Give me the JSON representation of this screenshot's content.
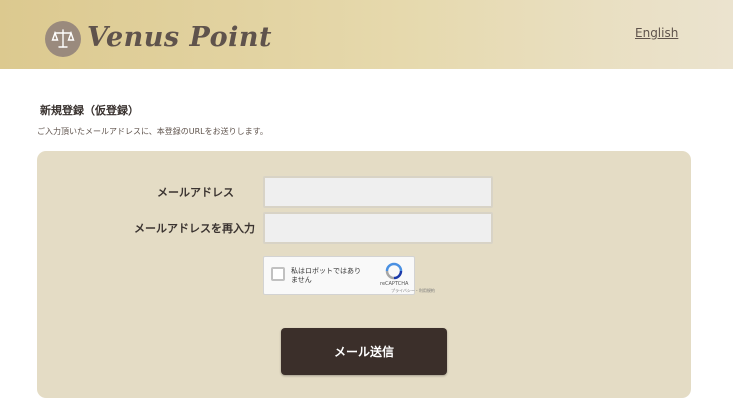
{
  "header": {
    "logo_text": "Venus Point",
    "language_link": "English",
    "logo_icon": "scales-icon"
  },
  "page": {
    "title": "新規登録（仮登録）",
    "description": "ご入力頂いたメールアドレスに、本登録のURLをお送りします。"
  },
  "form": {
    "email_label": "メールアドレス",
    "email_value": "",
    "email_confirm_label": "メールアドレスを再入力",
    "email_confirm_value": "",
    "recaptcha_label": "私はロボットではありません",
    "recaptcha_brand": "reCAPTCHA",
    "recaptcha_terms": "プライバシー・利用規約",
    "recaptcha_checked": false,
    "submit_label": "メール送信"
  },
  "colors": {
    "header_gradient_start": "#dcc98f",
    "header_gradient_end": "#ebe3cf",
    "panel_bg": "#e4dcc5",
    "button_bg": "#3b2f2a"
  }
}
